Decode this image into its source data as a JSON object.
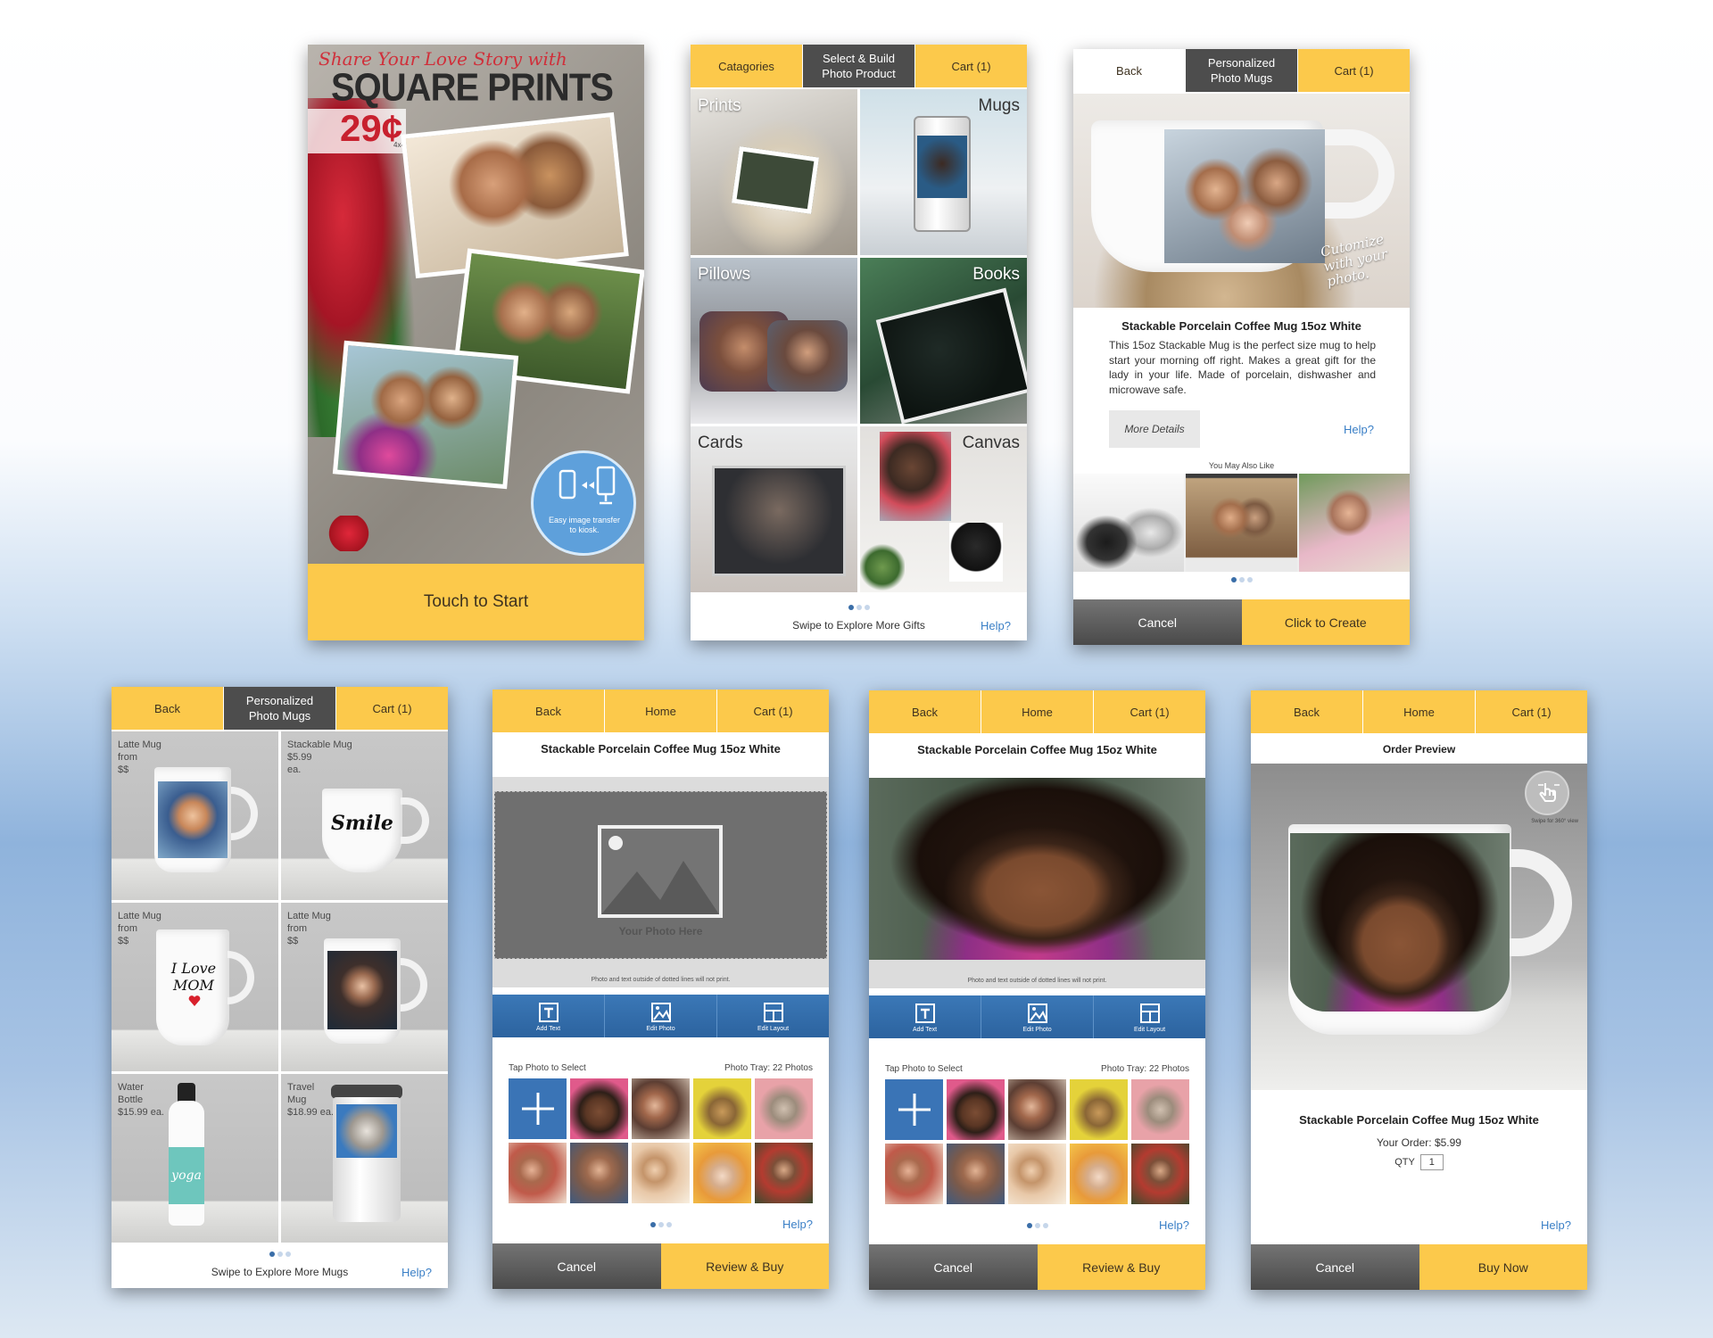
{
  "attract": {
    "headline_script": "Share Your Love Story with",
    "headline_main": "SQUARE PRINTS",
    "price": "29¢",
    "price_size": "4x4",
    "transfer_badge": "Easy image transfer to kiosk.",
    "start_button": "Touch to Start"
  },
  "categories": {
    "nav": [
      "Catagories",
      "Select & Build\nPhoto Product",
      "Cart (1)"
    ],
    "tiles": [
      "Prints",
      "Mugs",
      "Pillows",
      "Books",
      "Cards",
      "Canvas"
    ],
    "swipe_text": "Swipe to Explore More Gifts",
    "help": "Help?"
  },
  "detail": {
    "nav": [
      "Back",
      "Personalized\nPhoto Mugs",
      "Cart (1)"
    ],
    "callout": "Cutomize with your photo.",
    "product_title": "Stackable Porcelain Coffee Mug 15oz White",
    "description": "This 15oz Stackable Mug is the perfect size mug to help start your morning off right. Makes a great gift for the lady in your life. Made of porcelain, dishwasher and microwave safe.",
    "more_details": "More Details",
    "help": "Help?",
    "also_like": "You May Also Like",
    "cancel": "Cancel",
    "create": "Click to Create"
  },
  "mugs": {
    "nav": [
      "Back",
      "Personalized\nPhoto Mugs",
      "Cart (1)"
    ],
    "items": [
      {
        "info": "Latte Mug\nfrom\n$$"
      },
      {
        "info": "Stackable Mug\n$5.99\nea.",
        "mug_text": "Smile"
      },
      {
        "info": "Latte Mug\nfrom\n$$",
        "mug_text": "I Love MOM"
      },
      {
        "info": "Latte Mug\nfrom\n$$"
      },
      {
        "info": "Water\nBottle\n$15.99 ea.",
        "bottle_text": "yoga"
      },
      {
        "info": "Travel\nMug\n$18.99 ea."
      }
    ],
    "swipe_text": "Swipe to Explore More Mugs",
    "help": "Help?"
  },
  "editor_empty": {
    "nav": [
      "Back",
      "Home",
      "Cart (1)"
    ],
    "title": "Stackable Porcelain Coffee Mug 15oz White",
    "placeholder": "Your Photo Here",
    "note": "Photo and text outside of dotted lines will not print.",
    "tools": [
      "Add Text",
      "Edit Photo",
      "Edit Layout"
    ],
    "tray_label": "Tap Photo to Select",
    "tray_count": "Photo Tray: 22 Photos",
    "help": "Help?",
    "cancel": "Cancel",
    "review": "Review & Buy"
  },
  "editor_filled": {
    "nav": [
      "Back",
      "Home",
      "Cart (1)"
    ],
    "title": "Stackable Porcelain Coffee Mug 15oz White",
    "note": "Photo and text outside of dotted lines will not print.",
    "tools": [
      "Add Text",
      "Edit Photo",
      "Edit Layout"
    ],
    "tray_label": "Tap Photo to Select",
    "tray_count": "Photo Tray: 22 Photos",
    "help": "Help?",
    "cancel": "Cancel",
    "review": "Review & Buy"
  },
  "preview": {
    "nav": [
      "Back",
      "Home",
      "Cart (1)"
    ],
    "title": "Order Preview",
    "swipe_hint": "Swipe for 360° view",
    "product_title": "Stackable Porcelain Coffee Mug 15oz White",
    "your_order": "Your Order: $5.99",
    "qty_label": "QTY",
    "qty_value": "1",
    "help": "Help?",
    "cancel": "Cancel",
    "buy": "Buy Now"
  },
  "colors": {
    "accent_yellow": "#fcc94b",
    "active_tab": "#4d4d4d",
    "toolbar_blue": "#2f6aa8",
    "link_blue": "#3a7fc6"
  }
}
